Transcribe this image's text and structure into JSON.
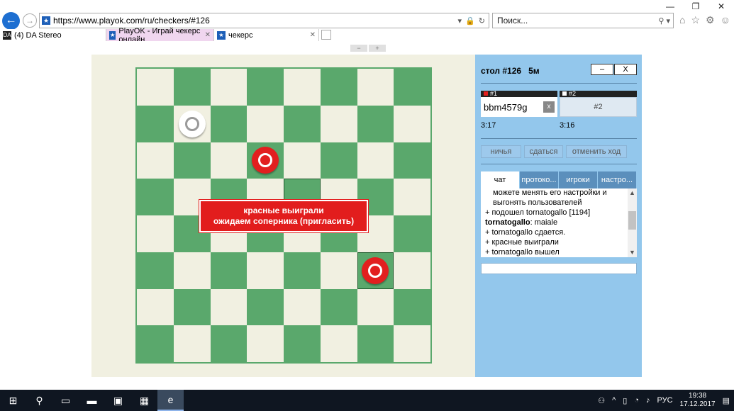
{
  "window": {
    "minimize": "—",
    "restore": "❐",
    "close": "✕"
  },
  "address": {
    "url_prefix": "https://www.",
    "url_domain": "playok.com",
    "url_rest": "/ru/checkers/#126"
  },
  "search": {
    "placeholder": "Поиск..."
  },
  "tabs": [
    {
      "label": "(4) DA Stereo",
      "favicon": "DA"
    },
    {
      "label": "PlayOK - Играй чекерс онлайн",
      "favicon": "★"
    },
    {
      "label": "чекерс",
      "favicon": "★"
    }
  ],
  "game": {
    "board": [
      [
        "",
        "",
        "",
        "",
        "",
        "",
        "",
        ""
      ],
      [
        "",
        "white",
        "",
        "",
        "",
        "",
        "",
        ""
      ],
      [
        "",
        "",
        "",
        "red",
        "",
        "",
        "",
        ""
      ],
      [
        "",
        "",
        "",
        "",
        "",
        "",
        "",
        ""
      ],
      [
        "",
        "",
        "",
        "",
        "",
        "",
        "",
        ""
      ],
      [
        "",
        "",
        "",
        "",
        "",
        "",
        "red",
        ""
      ],
      [
        "",
        "",
        "",
        "",
        "",
        "",
        "",
        ""
      ],
      [
        "",
        "",
        "",
        "",
        "",
        "",
        "",
        ""
      ]
    ],
    "highlight": [
      [
        3,
        4
      ],
      [
        5,
        6
      ]
    ],
    "banner": {
      "line1": "красные выиграли",
      "line2": "ожидаем соперника (пригласить)"
    }
  },
  "panel": {
    "title": "стол #126   5м",
    "minus": "–",
    "close": "X",
    "p1": {
      "seat": "#1",
      "name": "bbm4579g",
      "time": "3:17",
      "color": "#e21f1f"
    },
    "p2": {
      "seat": "#2",
      "name": "#2",
      "time": "3:16",
      "color": "#ffffff"
    },
    "kick": "x",
    "draw": "ничья",
    "resign": "сдаться",
    "undo": "отменить ход",
    "tabs": [
      "чат",
      "протоко...",
      "игроки",
      "настро..."
    ],
    "chat": [
      {
        "text": "можете менять его настройки и",
        "cont": true
      },
      {
        "text": "выгонять пользователей",
        "cont": true
      },
      {
        "text": "+ подошел tornatogallo [1194]"
      },
      {
        "user": "tornatogallo",
        "text": ": maiale"
      },
      {
        "text": "+ tornatogallo сдается."
      },
      {
        "text": "+ красные выиграли"
      },
      {
        "text": "+ tornatogallo вышел"
      }
    ]
  },
  "taskbar": {
    "lang": "РУС",
    "time": "19:38",
    "date": "17.12.2017"
  }
}
